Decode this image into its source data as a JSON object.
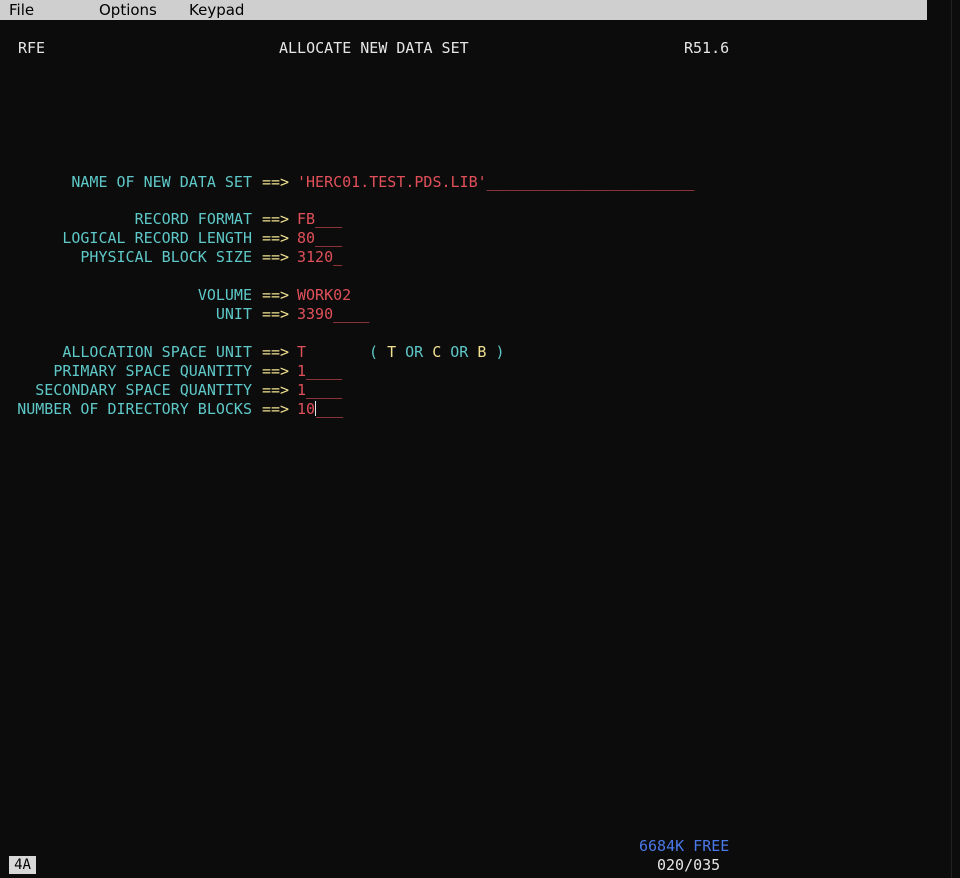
{
  "menu": {
    "file": "File",
    "options": "Options",
    "keypad": "Keypad"
  },
  "header": {
    "left": "RFE",
    "title": "ALLOCATE NEW DATA SET",
    "version": "R51.6"
  },
  "arrow": "==>",
  "fields": {
    "dsname": {
      "label": "NAME OF NEW DATA SET",
      "value": "'HERC01.TEST.PDS.LIB'_______________________"
    },
    "recfm": {
      "label": "RECORD FORMAT",
      "value": "FB___"
    },
    "lrecl": {
      "label": "LOGICAL RECORD LENGTH",
      "value": "80___"
    },
    "blksize": {
      "label": "PHYSICAL BLOCK SIZE",
      "value": "3120_"
    },
    "volume": {
      "label": "VOLUME",
      "value": "WORK02"
    },
    "unit": {
      "label": "UNIT",
      "value": "3390____"
    },
    "spaceunit": {
      "label": "ALLOCATION SPACE UNIT",
      "value": "T"
    },
    "primary": {
      "label": "PRIMARY SPACE QUANTITY",
      "value": "1____"
    },
    "secondary": {
      "label": "SECONDARY SPACE QUANTITY",
      "value": "1____"
    },
    "dirblocks": {
      "label": "NUMBER OF DIRECTORY BLOCKS",
      "value_before": "10",
      "value_after": "___"
    }
  },
  "hint": {
    "open": "(",
    "t": "T",
    "or1": "OR",
    "c": "C",
    "or2": "OR",
    "b": "B",
    "close": ")"
  },
  "status": {
    "free": "6684K FREE",
    "position": "020/035",
    "indicator": "4A"
  }
}
